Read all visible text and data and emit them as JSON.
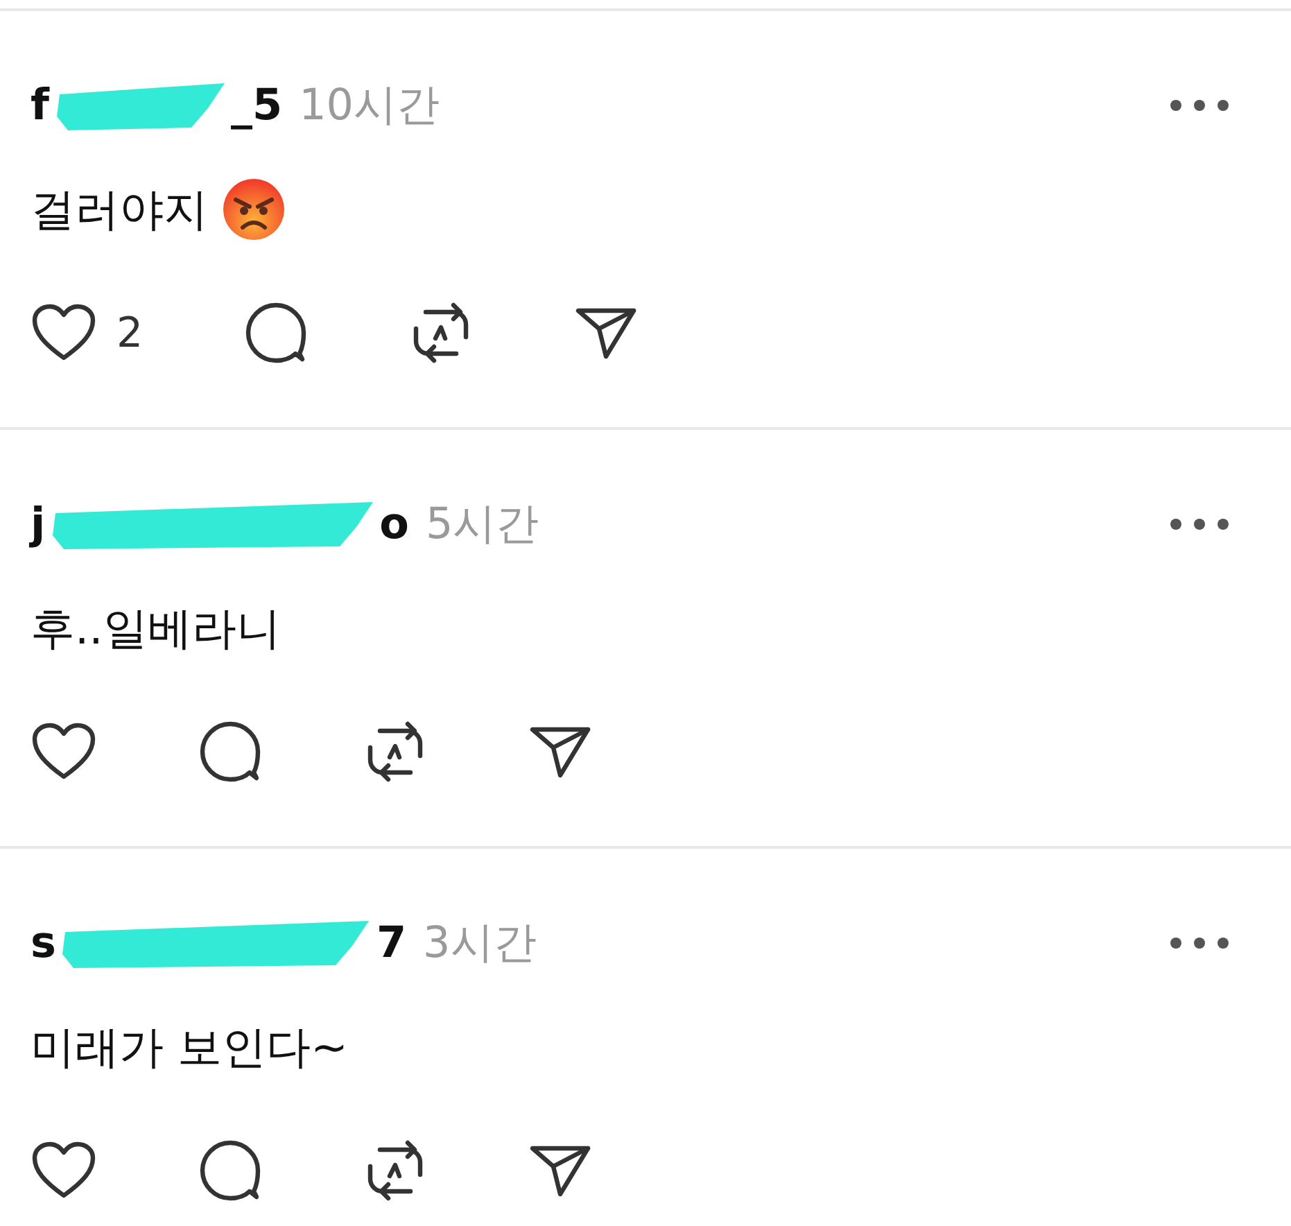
{
  "posts": [
    {
      "username_start": "f",
      "username_end": "_5",
      "time": "10시간",
      "text": "걸러야지",
      "angry_emoji": true,
      "likes": "2"
    },
    {
      "username_start": "j",
      "username_end": "o",
      "time": "5시간",
      "text": "후..일베라니"
    },
    {
      "username_start": "s",
      "username_end": "7",
      "time": "3시간",
      "text": "미래가 보인다~"
    }
  ]
}
